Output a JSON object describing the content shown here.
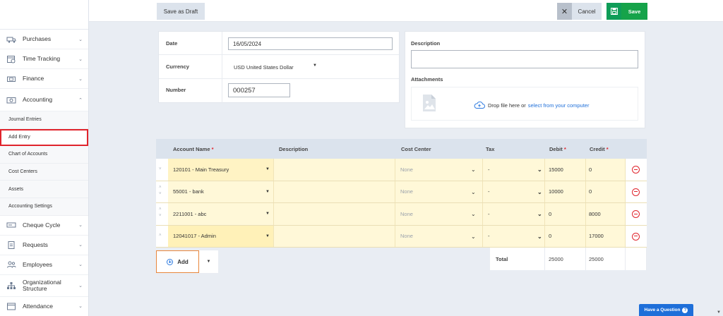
{
  "sidebar": {
    "items_top": [
      {
        "label": "Purchases",
        "icon": "truck-icon"
      },
      {
        "label": "Time Tracking",
        "icon": "calendar-clock-icon"
      },
      {
        "label": "Finance",
        "icon": "cash-icon"
      },
      {
        "label": "Accounting",
        "icon": "money-icon",
        "expanded": true
      }
    ],
    "sub_items": [
      "Journal Entries",
      "Add Entry",
      "Chart of Accounts",
      "Cost Centers",
      "Assets",
      "Accounting Settings"
    ],
    "active_sub": "Add Entry",
    "items_bottom": [
      {
        "label": "Cheque Cycle",
        "icon": "cheque-icon"
      },
      {
        "label": "Requests",
        "icon": "clipboard-icon"
      },
      {
        "label": "Employees",
        "icon": "people-icon"
      },
      {
        "label_line1": "Organizational",
        "label_line2": "Structure",
        "icon": "org-chart-icon"
      },
      {
        "label": "Attendance",
        "icon": "attendance-icon"
      }
    ]
  },
  "toolbar": {
    "draft_label": "Save as Draft",
    "cancel_label": "Cancel",
    "save_label": "Save"
  },
  "form": {
    "date_label": "Date",
    "date_value": "16/05/2024",
    "currency_label": "Currency",
    "currency_value": "USD United States Dollar",
    "number_label": "Number",
    "number_value": "000257",
    "description_label": "Description",
    "attachments_label": "Attachments",
    "drop_text": "Drop file here or",
    "drop_link": "select from your computer"
  },
  "table": {
    "headers": {
      "account": "Account Name",
      "description": "Description",
      "cost_center": "Cost Center",
      "tax": "Tax",
      "debit": "Debit",
      "credit": "Credit",
      "required_mark": "*"
    },
    "rows": [
      {
        "account": "120101 - Main Treasury",
        "cost_center": "None",
        "tax": "-",
        "debit": "15000",
        "credit": "0"
      },
      {
        "account": "55001 - bank",
        "cost_center": "None",
        "tax": "-",
        "debit": "10000",
        "credit": "0"
      },
      {
        "account": "2211001 - abc",
        "cost_center": "None",
        "tax": "-",
        "debit": "0",
        "credit": "8000"
      },
      {
        "account": "12041017 - Admin",
        "cost_center": "None",
        "tax": "-",
        "debit": "0",
        "credit": "17000"
      }
    ],
    "total_label": "Total",
    "total_debit": "25000",
    "total_credit": "25000",
    "add_label": "Add"
  },
  "help": {
    "label": "Have a Question",
    "q": "?"
  },
  "colors": {
    "accent": "#1e6fd9",
    "save": "#16a34a",
    "danger": "#e0242c",
    "row_bg": "#fff8d8"
  }
}
